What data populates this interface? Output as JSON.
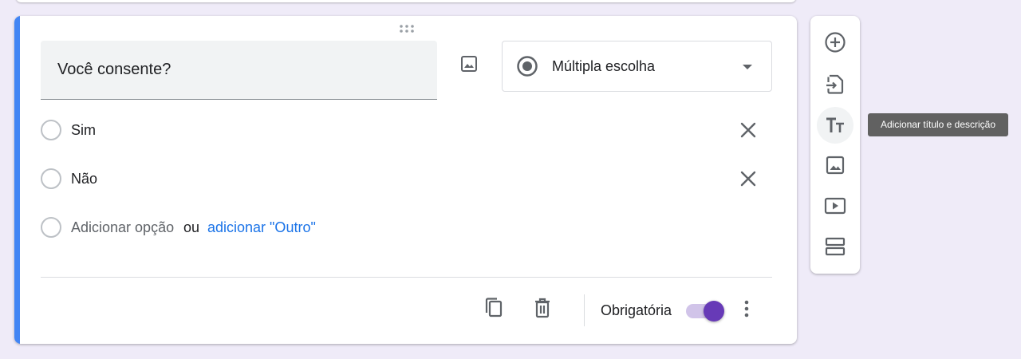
{
  "question": {
    "title": "Você consente?",
    "type_label": "Múltipla escolha",
    "options": [
      "Sim",
      "Não"
    ],
    "add_option_label": "Adicionar opção",
    "or_label": "ou",
    "add_other_label": "adicionar \"Outro\""
  },
  "footer": {
    "required_label": "Obrigatória",
    "required_on": true
  },
  "toolbar": {
    "tooltip": "Adicionar título e descrição",
    "items": [
      "add-question-icon",
      "import-questions-icon",
      "add-title-description-icon",
      "add-image-icon",
      "add-video-icon",
      "add-section-icon"
    ]
  },
  "colors": {
    "accent": "#4285f4",
    "toggle": "#673ab7",
    "link": "#1a73e8",
    "background": "#efebf8"
  }
}
